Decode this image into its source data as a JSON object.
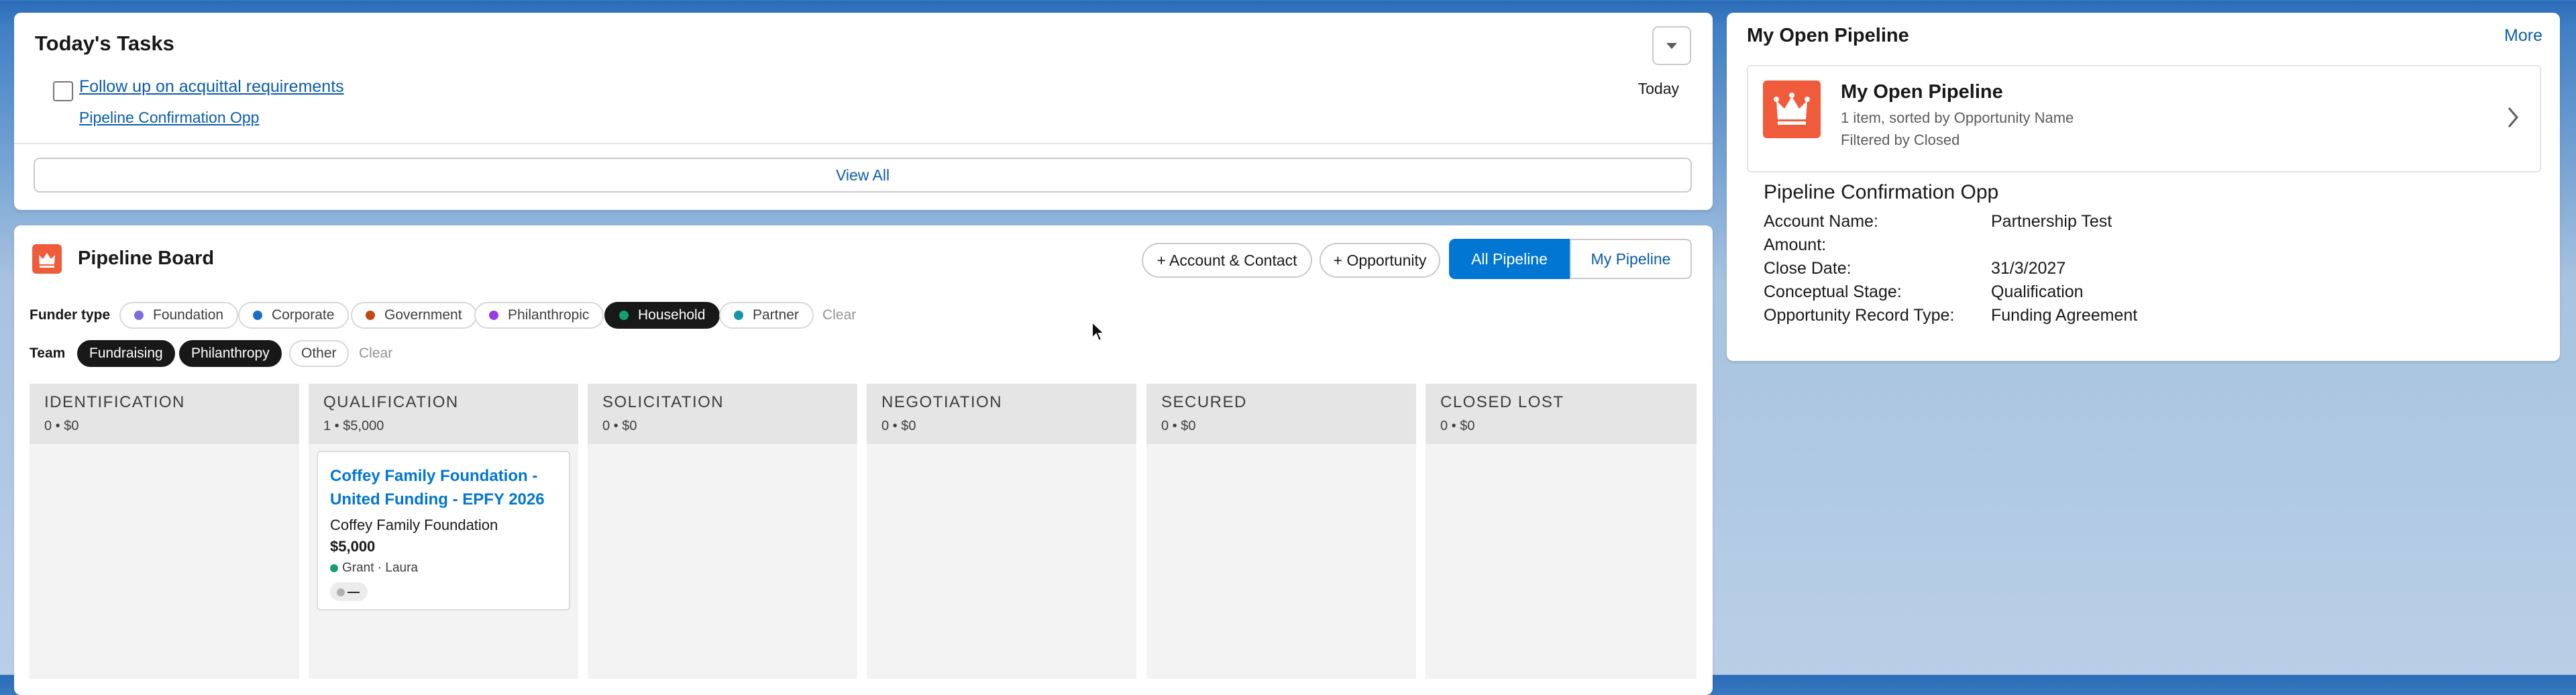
{
  "tasks": {
    "title": "Today's Tasks",
    "items": [
      {
        "subject": "Follow up on acquittal requirements",
        "related": "Pipeline Confirmation Opp",
        "due": "Today"
      }
    ],
    "view_all": "View All"
  },
  "board": {
    "title": "Pipeline Board",
    "buttons": {
      "add_account": "+ Account & Contact",
      "add_opportunity": "+ Opportunity",
      "all_pipeline": "All Pipeline",
      "my_pipeline": "My Pipeline"
    },
    "funder_label": "Funder type",
    "funder_types": [
      {
        "label": "Foundation",
        "color": "#7f6ae0",
        "selected": false
      },
      {
        "label": "Corporate",
        "color": "#1b6fc7",
        "selected": false
      },
      {
        "label": "Government",
        "color": "#c4461a",
        "selected": false
      },
      {
        "label": "Philanthropic",
        "color": "#9b3ce0",
        "selected": false
      },
      {
        "label": "Household",
        "color": "#13a06f",
        "selected": true
      },
      {
        "label": "Partner",
        "color": "#1694a8",
        "selected": false
      }
    ],
    "funder_clear": "Clear",
    "team_label": "Team",
    "teams": [
      {
        "label": "Fundraising",
        "selected": true
      },
      {
        "label": "Philanthropy",
        "selected": true
      },
      {
        "label": "Other",
        "selected": false
      }
    ],
    "team_clear": "Clear",
    "columns": [
      {
        "title": "IDENTIFICATION",
        "summary": "0 • $0"
      },
      {
        "title": "QUALIFICATION",
        "summary": "1 • $5,000"
      },
      {
        "title": "SOLICITATION",
        "summary": "0 • $0"
      },
      {
        "title": "NEGOTIATION",
        "summary": "0 • $0"
      },
      {
        "title": "SECURED",
        "summary": "0 • $0"
      },
      {
        "title": "CLOSED LOST",
        "summary": "0 • $0"
      }
    ],
    "card": {
      "title_line1": "Coffey Family Foundation -",
      "title_line2": "United Funding - EPFY 2026",
      "account": "Coffey Family Foundation",
      "amount": "$5,000",
      "meta": "Grant · Laura",
      "meta_color": "#13a06f",
      "badge": "—"
    }
  },
  "pipeline": {
    "header": "My Open Pipeline",
    "more": "More",
    "list_name": "My Open Pipeline",
    "list_sub1": "1 item, sorted by Opportunity Name",
    "list_sub2": "Filtered by Closed",
    "record_title": "Pipeline Confirmation Opp",
    "fields": [
      {
        "label": "Account Name:",
        "value": "Partnership Test"
      },
      {
        "label": "Amount:",
        "value": ""
      },
      {
        "label": "Close Date:",
        "value": "31/3/2027"
      },
      {
        "label": "Conceptual Stage:",
        "value": "Qualification"
      },
      {
        "label": "Opportunity Record Type:",
        "value": "Funding Agreement"
      }
    ]
  },
  "colors": {
    "brand": "#0176d3",
    "icon_orange": "#f05b3c"
  }
}
